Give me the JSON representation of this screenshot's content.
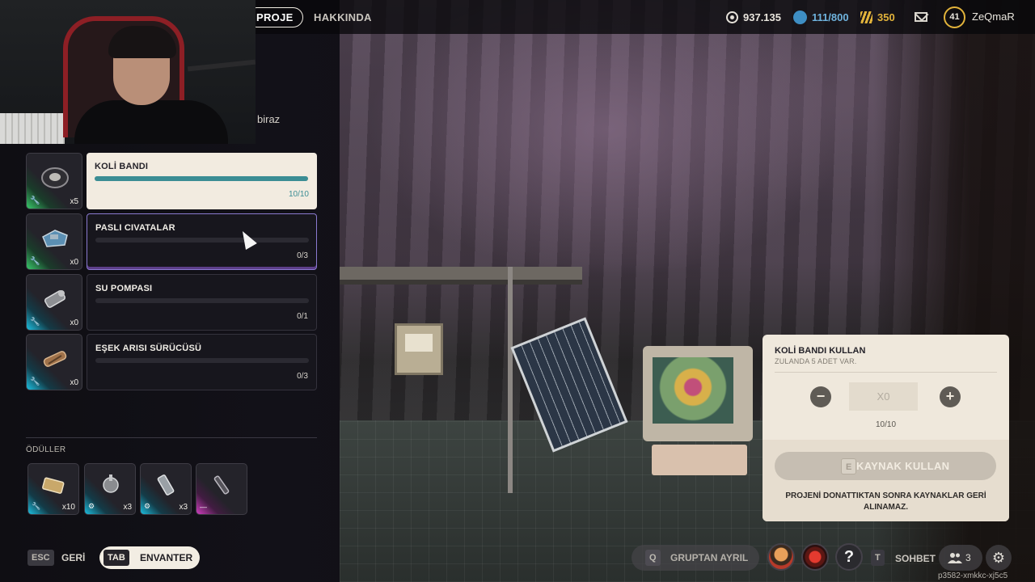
{
  "topbar": {
    "tabs": [
      {
        "label": "PROJE",
        "active": true
      },
      {
        "label": "HAKKINDA",
        "active": false
      }
    ],
    "currency": {
      "coins": "937.135",
      "seasonal": "111/800",
      "gold": "350"
    },
    "level": "41",
    "username": "ZeQmaR"
  },
  "partial_text": "biraz",
  "project_items": [
    {
      "name": "KOLİ BANDI",
      "owned": "x5",
      "progress": "10/10",
      "fraction": 1.0,
      "completed": true,
      "icon": "tape-roll-icon"
    },
    {
      "name": "PASLI CIVATALAR",
      "owned": "x0",
      "progress": "0/3",
      "fraction": 0.0,
      "completed": false,
      "icon": "rusty-bolts-icon"
    },
    {
      "name": "SU POMPASI",
      "owned": "x0",
      "progress": "0/1",
      "fraction": 0.0,
      "completed": false,
      "icon": "water-pump-icon"
    },
    {
      "name": "EŞEK ARISI SÜRÜCÜSÜ",
      "owned": "x0",
      "progress": "0/3",
      "fraction": 0.0,
      "completed": false,
      "icon": "wasp-driver-icon"
    }
  ],
  "rewards": {
    "title": "ÖDÜLLER",
    "items": [
      {
        "qty": "x10",
        "icon": "component-icon"
      },
      {
        "qty": "x3",
        "icon": "motor-icon"
      },
      {
        "qty": "x3",
        "icon": "battery-icon"
      },
      {
        "qty": "",
        "icon": "weapon-part-icon"
      }
    ]
  },
  "controls": {
    "back_key": "ESC",
    "back_label": "GERİ",
    "inventory_key": "TAB",
    "inventory_label": "ENVANTER",
    "leave_key": "Q",
    "leave_label": "GRUPTAN AYRIL",
    "chat_key": "T",
    "chat_label": "SOHBET",
    "group_count": "3",
    "session_id": "p3582-xmkkc-xj5c5"
  },
  "dialog": {
    "title": "KOLİ BANDI KULLAN",
    "subtitle": "ZULANDA 5 ADET VAR.",
    "quantity": "X0",
    "count": "10/10",
    "use_key": "E",
    "use_label": "KAYNAK KULLAN",
    "note": "PROJENİ DONATTIKTAN SONRA KAYNAKLAR GERİ ALINAMAZ."
  },
  "colors": {
    "accent_teal": "#3b8d94",
    "gold": "#e2b33b",
    "seasonal_blue": "#6fb3de",
    "rarity_uncommon": "#39c96b",
    "rarity_rare": "#1dbfe0",
    "rarity_epic": "#d23fc1"
  }
}
